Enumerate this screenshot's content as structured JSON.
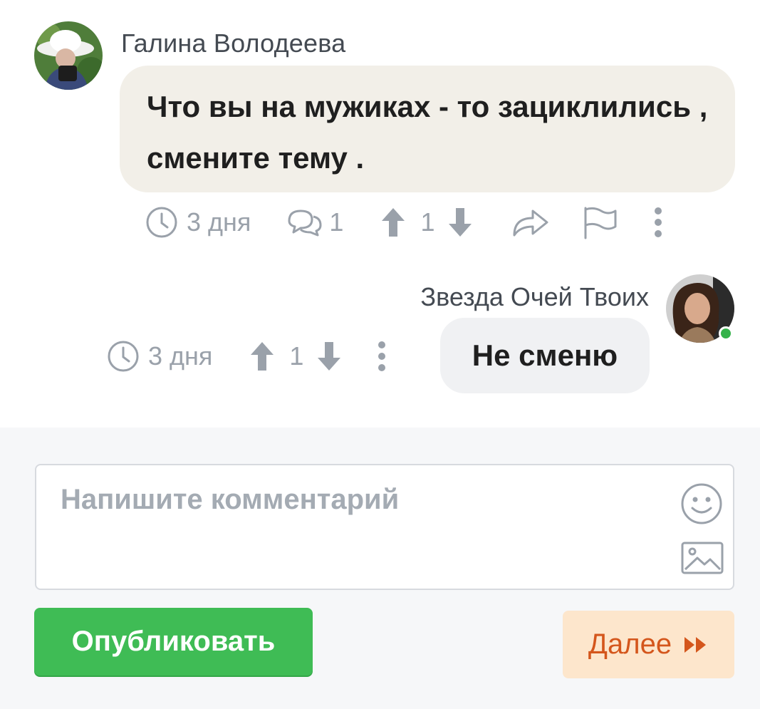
{
  "comments": [
    {
      "author": "Галина Володеева",
      "text": "Что вы на мужиках - то зациклились , смените тему .",
      "time": "3 дня",
      "replies": "1",
      "votes": "1"
    },
    {
      "author": "Звезда Очей Твоих",
      "text": "Не сменю",
      "time": "3 дня",
      "votes": "1",
      "online": true
    }
  ],
  "form": {
    "placeholder": "Напишите комментарий",
    "publish_label": "Опубликовать",
    "next_label": "Далее"
  },
  "icons": {
    "time": "clock-icon",
    "replies": "speech-bubbles-icon",
    "upvote": "arrow-up-icon",
    "downvote": "arrow-down-icon",
    "share": "share-arrow-icon",
    "report": "flag-icon",
    "more": "more-vertical-icon",
    "emoji": "smiley-icon",
    "image": "image-icon",
    "next": "double-chevron-right-icon"
  },
  "colors": {
    "incoming_bubble": "#f2efe8",
    "own_bubble": "#f0f1f3",
    "publish": "#3fbc55",
    "next_bg": "#fde6cc",
    "next_text": "#d4561c",
    "online": "#35b24a",
    "meta": "#9aa1aa"
  }
}
